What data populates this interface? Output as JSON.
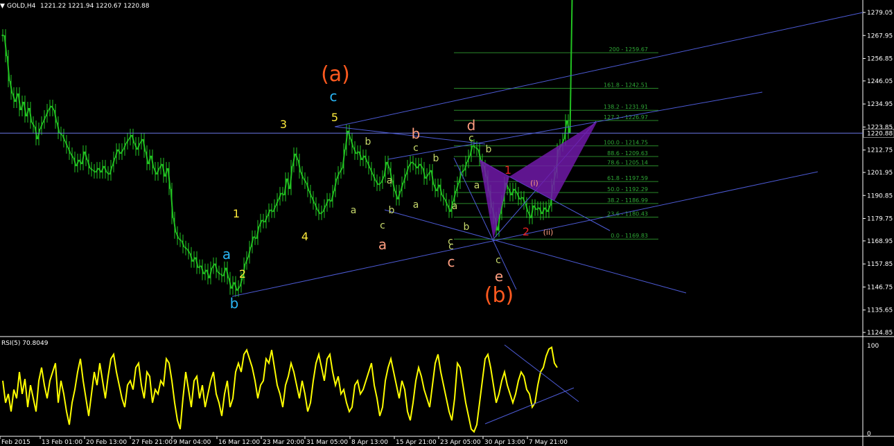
{
  "header": {
    "symbol": "GOLD,H4",
    "ohlc": "1221.22 1221.94 1220.67 1220.88"
  },
  "colors": {
    "background": "#000000",
    "candle": "#22c322",
    "channel": "#4d5bd6",
    "fib": "#2a8a2a",
    "fib_text": "#2fa836",
    "pattern": "#7019a8",
    "rsi": "#ffff00",
    "wave_orange": "#ff5a1f",
    "wave_cyan": "#29b6f6",
    "wave_yellow": "#ffeb3b",
    "wave_salmon": "#ff9e80",
    "wave_green": "#c6d86c",
    "wave_red": "#e32020"
  },
  "current_price_label": "1220.88",
  "chart_data": [
    {
      "type": "line",
      "name": "GOLD,H4",
      "ylim": [
        1124.85,
        1279.05
      ],
      "y_ticks": [
        "1279.05",
        "1267.95",
        "1256.85",
        "1246.05",
        "1234.95",
        "1223.85",
        "1212.75",
        "1201.95",
        "1190.85",
        "1179.75",
        "1168.95",
        "1157.85",
        "1146.75",
        "1135.65",
        "1124.85"
      ],
      "x_ticks": [
        "Feb 2015",
        "13 Feb 01:00",
        "20 Feb 13:00",
        "27 Feb 21:00",
        "9 Mar 04:00",
        "16 Mar 12:00",
        "23 Mar 20:00",
        "31 Mar 05:00",
        "8 Apr 13:00",
        "15 Apr 21:00",
        "23 Apr 05:00",
        "30 Apr 13:00",
        "7 May 21:00"
      ],
      "x": [
        0,
        4,
        8,
        12,
        16,
        20,
        24,
        28,
        32,
        36,
        40,
        44,
        48,
        52,
        56,
        60,
        64,
        68,
        72,
        76,
        80,
        84,
        88,
        92,
        96,
        100,
        104,
        108,
        112,
        116,
        120,
        124,
        128,
        132,
        136,
        140,
        144,
        148,
        152,
        156,
        160,
        164,
        168,
        172,
        176,
        180,
        184,
        188,
        192,
        196,
        200,
        204,
        208,
        212,
        216,
        220,
        224,
        228,
        232,
        236,
        240,
        244,
        248,
        252,
        256,
        260,
        264,
        268,
        272,
        276,
        280,
        284,
        288,
        292,
        296,
        300,
        304,
        308,
        312,
        316,
        320,
        324,
        328,
        332,
        336,
        340,
        344,
        348,
        352,
        356,
        360,
        364,
        368,
        372,
        376,
        380,
        384,
        388,
        392,
        396,
        400,
        404,
        408,
        412,
        416,
        420,
        424,
        428,
        432,
        436,
        440,
        444,
        448,
        452,
        456,
        460,
        464,
        468,
        472,
        476,
        480,
        484,
        488,
        492,
        496,
        500,
        504,
        508,
        512,
        516,
        520,
        524,
        528,
        532,
        536,
        540,
        544,
        548,
        552,
        556,
        560,
        564,
        568,
        572,
        576,
        580,
        584,
        588,
        592,
        596,
        600,
        604,
        608,
        612,
        616,
        620,
        624,
        628,
        632,
        636,
        640,
        644,
        648,
        652,
        656,
        660,
        664,
        668,
        672,
        676,
        680,
        684,
        688,
        692,
        696,
        700,
        704,
        708,
        712,
        716,
        720,
        724,
        728,
        732,
        736,
        740,
        744,
        748,
        752,
        756,
        760,
        764,
        768,
        772,
        776,
        780,
        784,
        788,
        792,
        796,
        800,
        804,
        808,
        812,
        816,
        820
      ],
      "close": [
        1268,
        1258,
        1246,
        1240,
        1236,
        1240,
        1232,
        1236,
        1229,
        1233,
        1226,
        1224,
        1218,
        1223,
        1226,
        1229,
        1232,
        1234,
        1232,
        1226,
        1221,
        1220,
        1217,
        1214,
        1211,
        1209,
        1205,
        1208,
        1206,
        1212,
        1208,
        1204,
        1203,
        1202,
        1204,
        1202,
        1205,
        1202,
        1201,
        1205,
        1209,
        1213,
        1211,
        1213,
        1216,
        1218,
        1220,
        1216,
        1213,
        1216,
        1218,
        1212,
        1206,
        1210,
        1204,
        1201,
        1204,
        1206,
        1200,
        1204,
        1194,
        1180,
        1173,
        1170,
        1169,
        1166,
        1165,
        1163,
        1159,
        1161,
        1156,
        1157,
        1153,
        1155,
        1151,
        1156,
        1158,
        1154,
        1153,
        1152,
        1156,
        1151,
        1146,
        1149,
        1145,
        1147,
        1151,
        1158,
        1161,
        1166,
        1171,
        1170,
        1176,
        1179,
        1178,
        1181,
        1184,
        1183,
        1186,
        1189,
        1192,
        1191,
        1199,
        1194,
        1205,
        1211,
        1208,
        1202,
        1199,
        1197,
        1193,
        1190,
        1187,
        1184,
        1182,
        1183,
        1186,
        1189,
        1188,
        1193,
        1199,
        1202,
        1204,
        1213,
        1222,
        1218,
        1214,
        1211,
        1212,
        1208,
        1210,
        1207,
        1204,
        1201,
        1198,
        1196,
        1197,
        1200,
        1207,
        1204,
        1198,
        1193,
        1189,
        1193,
        1197,
        1201,
        1205,
        1207,
        1206,
        1204,
        1206,
        1204,
        1199,
        1201,
        1203,
        1196,
        1193,
        1196,
        1191,
        1189,
        1186,
        1183,
        1188,
        1193,
        1197,
        1202,
        1203,
        1207,
        1210,
        1215,
        1214,
        1213,
        1208,
        1205,
        1200,
        1193,
        1185,
        1180,
        1174,
        1182,
        1188,
        1197,
        1194,
        1191,
        1194,
        1192,
        1189,
        1190,
        1187,
        1183,
        1180,
        1186,
        1184,
        1185,
        1182,
        1185,
        1183,
        1186,
        1196,
        1202,
        1213,
        1215,
        1218,
        1227,
        1221
      ]
    },
    {
      "type": "line",
      "name": "RSI(5) 70.8049",
      "ylim": [
        0,
        100
      ],
      "y_ticks": [
        "100",
        "0"
      ],
      "x": [
        0,
        4,
        8,
        12,
        16,
        20,
        24,
        28,
        32,
        36,
        40,
        44,
        48,
        52,
        56,
        60,
        64,
        68,
        72,
        76,
        80,
        84,
        88,
        92,
        96,
        100,
        104,
        108,
        112,
        116,
        120,
        124,
        128,
        132,
        136,
        140,
        144,
        148,
        152,
        156,
        160,
        164,
        168,
        172,
        176,
        180,
        184,
        188,
        192,
        196,
        200,
        204,
        208,
        212,
        216,
        220,
        224,
        228,
        232,
        236,
        240,
        244,
        248,
        252,
        256,
        260,
        264,
        268,
        272,
        276,
        280,
        284,
        288,
        292,
        296,
        300,
        304,
        308,
        312,
        316,
        320,
        324,
        328,
        332,
        336,
        340,
        344,
        348,
        352,
        356,
        360,
        364,
        368,
        372,
        376,
        380,
        384,
        388,
        392,
        396,
        400,
        404,
        408,
        412,
        416,
        420,
        424,
        428,
        432,
        436,
        440,
        444,
        448,
        452,
        456,
        460,
        464,
        468,
        472,
        476,
        480,
        484,
        488,
        492,
        496,
        500,
        504,
        508,
        512,
        516,
        520,
        524,
        528,
        532,
        536,
        540,
        544,
        548,
        552,
        556,
        560,
        564,
        568,
        572,
        576,
        580,
        584,
        588,
        592,
        596,
        600,
        604,
        608,
        612,
        616,
        620,
        624,
        628,
        632,
        636,
        640,
        644,
        648,
        652,
        656,
        660,
        664,
        668,
        672,
        676,
        680,
        684,
        688,
        692,
        696,
        700,
        704,
        708,
        712,
        716,
        720,
        724,
        728,
        732,
        736,
        740,
        744,
        748,
        752,
        756,
        760,
        764,
        768,
        772,
        776,
        780,
        784,
        788,
        792,
        796,
        800,
        804,
        808,
        812,
        816,
        820
      ],
      "values": [
        60,
        35,
        45,
        25,
        50,
        40,
        70,
        45,
        62,
        30,
        55,
        40,
        25,
        60,
        75,
        55,
        40,
        60,
        70,
        80,
        35,
        60,
        45,
        25,
        10,
        35,
        50,
        70,
        85,
        60,
        40,
        20,
        45,
        70,
        55,
        80,
        60,
        40,
        65,
        85,
        90,
        70,
        55,
        40,
        30,
        55,
        60,
        50,
        75,
        80,
        55,
        40,
        70,
        65,
        35,
        50,
        45,
        60,
        55,
        85,
        80,
        60,
        35,
        15,
        5,
        40,
        70,
        50,
        30,
        60,
        65,
        40,
        55,
        30,
        45,
        60,
        70,
        45,
        35,
        20,
        45,
        60,
        30,
        40,
        70,
        80,
        70,
        90,
        95,
        85,
        75,
        60,
        40,
        55,
        60,
        85,
        80,
        95,
        75,
        55,
        45,
        30,
        55,
        65,
        80,
        70,
        55,
        40,
        60,
        45,
        25,
        35,
        60,
        80,
        90,
        75,
        60,
        85,
        90,
        70,
        55,
        65,
        45,
        50,
        35,
        25,
        30,
        55,
        60,
        45,
        50,
        60,
        70,
        80,
        55,
        40,
        20,
        30,
        60,
        75,
        85,
        70,
        55,
        40,
        60,
        50,
        25,
        15,
        35,
        60,
        75,
        65,
        50,
        40,
        30,
        55,
        80,
        90,
        70,
        55,
        40,
        25,
        15,
        40,
        80,
        75,
        55,
        35,
        20,
        5,
        2,
        10,
        35,
        60,
        85,
        90,
        75,
        55,
        35,
        45,
        60,
        70,
        55,
        45,
        35,
        45,
        60,
        70,
        65,
        50,
        45,
        30,
        35,
        55,
        70,
        75,
        88,
        96,
        98,
        80,
        75
      ]
    }
  ],
  "fib_levels": [
    {
      "label": "200 - 1259.67",
      "price": 1259.67
    },
    {
      "label": "161.8 - 1242.51",
      "price": 1242.51
    },
    {
      "label": "138.2 - 1231.91",
      "price": 1231.91
    },
    {
      "label": "127.2 - 1226.97",
      "price": 1226.97
    },
    {
      "label": "100.0 - 1214.75",
      "price": 1214.75
    },
    {
      "label": "88.6 - 1209.63",
      "price": 1209.63
    },
    {
      "label": "78.6 - 1205.14",
      "price": 1205.14
    },
    {
      "label": "61.8 - 1197.59",
      "price": 1197.59
    },
    {
      "label": "50.0 - 1192.29",
      "price": 1192.29
    },
    {
      "label": "38.2 - 1186.99",
      "price": 1186.99
    },
    {
      "label": "23.6 - 1180.43",
      "price": 1180.43
    },
    {
      "label": "0.0 - 1169.83",
      "price": 1169.83
    }
  ],
  "wave_labels": [
    {
      "text": "(a)",
      "color": "wave_orange",
      "size": "xl"
    },
    {
      "text": "c",
      "color": "wave_cyan",
      "size": "lg"
    },
    {
      "text": "5",
      "color": "wave_yellow",
      "size": "md"
    },
    {
      "text": "3",
      "color": "wave_yellow",
      "size": "md"
    },
    {
      "text": "1",
      "color": "wave_yellow",
      "size": "md"
    },
    {
      "text": "4",
      "color": "wave_yellow",
      "size": "md"
    },
    {
      "text": "2",
      "color": "wave_yellow",
      "size": "md"
    },
    {
      "text": "a",
      "color": "wave_cyan",
      "size": "lg"
    },
    {
      "text": "b",
      "color": "wave_cyan",
      "size": "lg"
    },
    {
      "text": "b",
      "color": "wave_salmon",
      "size": "lg"
    },
    {
      "text": "a",
      "color": "wave_salmon",
      "size": "lg"
    },
    {
      "text": "c",
      "color": "wave_salmon",
      "size": "lg"
    },
    {
      "text": "d",
      "color": "wave_salmon",
      "size": "lg"
    },
    {
      "text": "e",
      "color": "wave_salmon",
      "size": "lg"
    },
    {
      "text": "(b)",
      "color": "wave_orange",
      "size": "xl"
    },
    {
      "text": "b",
      "color": "wave_green",
      "size": "sm"
    },
    {
      "text": "a",
      "color": "wave_green",
      "size": "sm"
    },
    {
      "text": "c",
      "color": "wave_green",
      "size": "sm"
    },
    {
      "text": "b",
      "color": "wave_green",
      "size": "sm"
    },
    {
      "text": "c",
      "color": "wave_green",
      "size": "sm"
    },
    {
      "text": "a",
      "color": "wave_green",
      "size": "sm"
    },
    {
      "text": "a",
      "color": "wave_green",
      "size": "sm"
    },
    {
      "text": "b",
      "color": "wave_green",
      "size": "sm"
    },
    {
      "text": "c",
      "color": "wave_green",
      "size": "sm"
    },
    {
      "text": "c",
      "color": "wave_green",
      "size": "sm"
    },
    {
      "text": "a",
      "color": "wave_green",
      "size": "sm"
    },
    {
      "text": "a",
      "color": "wave_green",
      "size": "sm"
    },
    {
      "text": "b",
      "color": "wave_green",
      "size": "sm"
    },
    {
      "text": "c",
      "color": "wave_green",
      "size": "sm"
    },
    {
      "text": "c",
      "color": "wave_green",
      "size": "sm"
    },
    {
      "text": "b",
      "color": "wave_green",
      "size": "sm"
    },
    {
      "text": "1",
      "color": "wave_red",
      "size": "md"
    },
    {
      "text": "2",
      "color": "wave_red",
      "size": "md"
    },
    {
      "text": "(i)",
      "color": "wave_salmon",
      "size": "xs"
    },
    {
      "text": "(ii)",
      "color": "wave_salmon",
      "size": "xs"
    }
  ]
}
